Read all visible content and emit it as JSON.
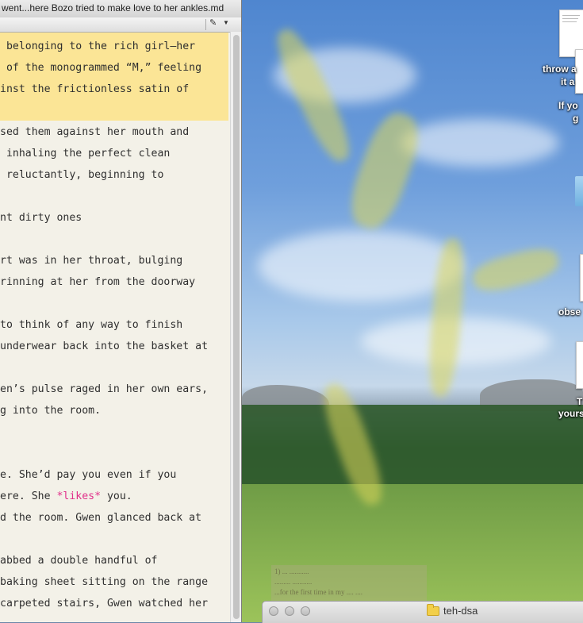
{
  "editor": {
    "window_title": "went...here Bozo tried to make love to her ankles.md",
    "toolbar": {
      "pen_icon": "pen-icon",
      "dropdown_icon": "chevron-down-icon"
    },
    "lines": [
      {
        "text": " belonging to the rich girl—her"
      },
      {
        "text": " of the monogrammed “M,” feeling"
      },
      {
        "text": "inst the frictionless satin of"
      },
      {
        "text": ""
      },
      {
        "text": "sed them against her mouth and"
      },
      {
        "text": " inhaling the perfect clean"
      },
      {
        "text": " reluctantly, beginning to"
      },
      {
        "text": ""
      },
      {
        "text": "nt dirty ones"
      },
      {
        "text": ""
      },
      {
        "text": "rt was in her throat, bulging"
      },
      {
        "text": "rinning at her from the doorway"
      },
      {
        "text": ""
      },
      {
        "text": "to think of any way to finish"
      },
      {
        "text": "underwear back into the basket at"
      },
      {
        "text": ""
      },
      {
        "text": "en’s pulse raged in her own ears,"
      },
      {
        "text": "g into the room."
      },
      {
        "text": ""
      },
      {
        "text": ""
      },
      {
        "text": "e. She’d pay you even if you"
      },
      {
        "text_before": "ere. She ",
        "emphasis": "*likes*",
        "text_after": " you."
      },
      {
        "text": "d the room. Gwen glanced back at"
      },
      {
        "text": ""
      },
      {
        "text": "abbed a double handful of"
      },
      {
        "text": "baking sheet sitting on the range"
      },
      {
        "text": "carpeted stairs, Gwen watched her"
      }
    ],
    "highlight_color": "#fbe596",
    "emphasis_color": "#e0308a"
  },
  "desktop": {
    "labels": {
      "throw_1": "throw a",
      "throw_2": "it a",
      "ifyou_1": "If yo",
      "ifyou_2": "g",
      "obse": "obse",
      "t_1": "T",
      "t_2": "yours"
    },
    "ghost_text": [
      "1) ... ...........",
      "......... ...........",
      "...for the first time in my .... ....",
      "..........."
    ]
  },
  "finder": {
    "folder_name": "teh-dsa"
  }
}
